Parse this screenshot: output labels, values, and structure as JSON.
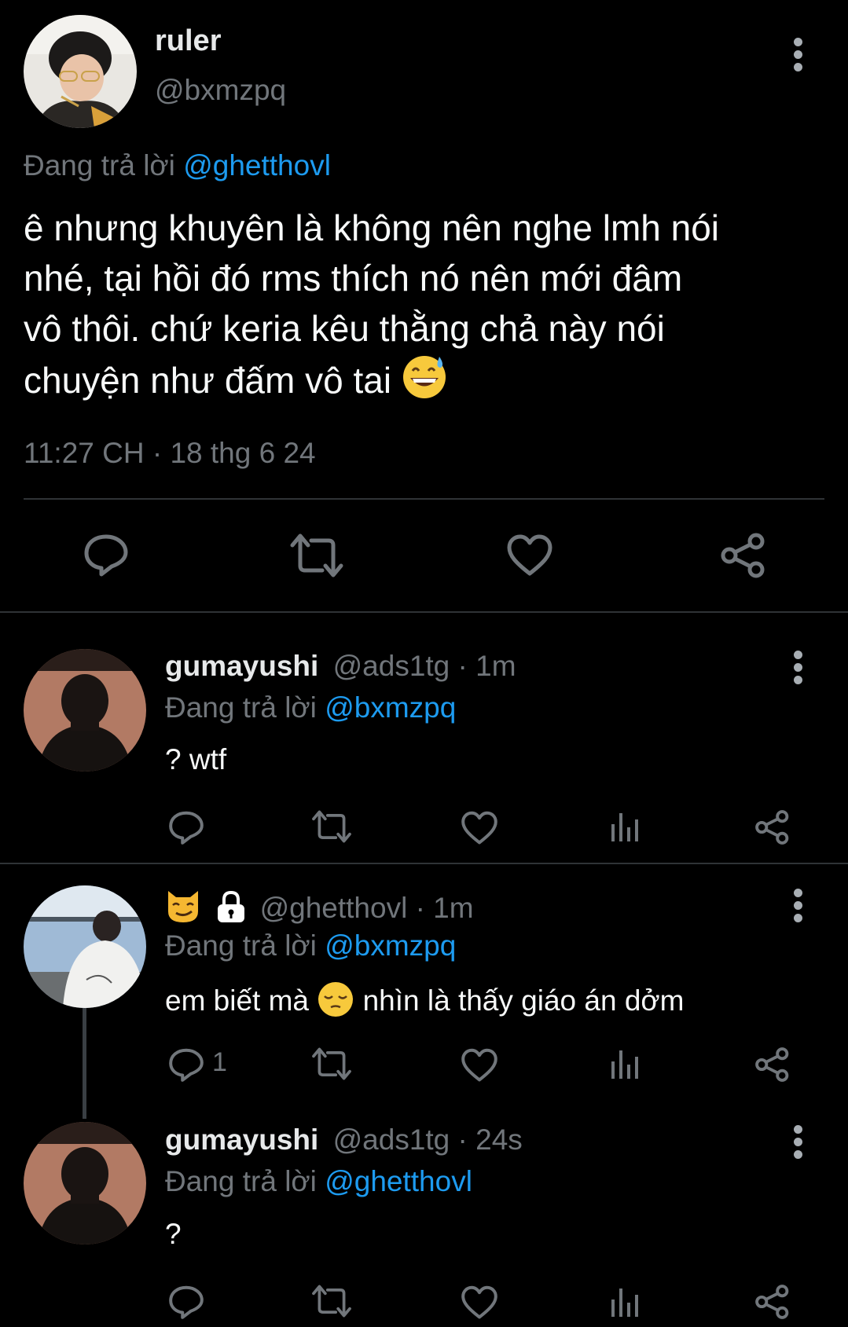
{
  "main_tweet": {
    "display_name": "ruler",
    "handle": "@bxmzpq",
    "replying_prefix": "Đang trả lời",
    "replying_to": "@ghetthovl",
    "text_lines": [
      "ê nhưng khuyên là không nên nghe lmh nói",
      "nhé, tại hồi đó rms thích nó nên mới đâm",
      "vô thôi. chứ keria kêu thằng chả này nói",
      "chuyện như đấm vô tai"
    ],
    "emoji": "grinning-face-with-sweat",
    "timestamp": "11:27 CH · 18 thg 6 24"
  },
  "replies": [
    {
      "display_name": "gumayushi",
      "handle": "@ads1tg",
      "time": "· 1m",
      "replying_prefix": "Đang trả lời",
      "replying_to": "@bxmzpq",
      "text": "? wtf"
    },
    {
      "display_name_icons": [
        "smirking-cat-icon",
        "lock-icon"
      ],
      "handle": "@ghetthovl",
      "time": "· 1m",
      "replying_prefix": "Đang trả lời",
      "replying_to": "@bxmzpq",
      "text_before_emoji": "em biết mà",
      "emoji": "pensive-face",
      "text_after_emoji": "nhìn là thấy giáo án dởm",
      "reply_count": "1"
    },
    {
      "display_name": "gumayushi",
      "handle": "@ads1tg",
      "time": "· 24s",
      "replying_prefix": "Đang trả lời",
      "replying_to": "@ghetthovl",
      "text": "?"
    }
  ],
  "colors": {
    "background": "#000000",
    "text": "#e7e9ea",
    "secondary": "#71767b",
    "link": "#1d9bf0",
    "divider": "#2f3336"
  }
}
